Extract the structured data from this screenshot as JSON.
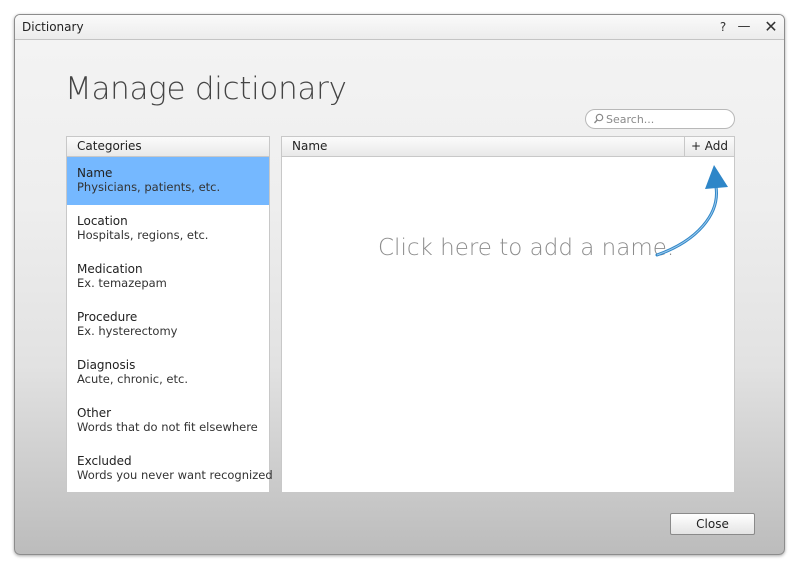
{
  "window": {
    "title": "Dictionary",
    "help_label": "?",
    "minimize_label": "—",
    "close_label": "✕"
  },
  "heading": "Manage dictionary",
  "search": {
    "placeholder": "Search..."
  },
  "categories": {
    "header": "Categories",
    "items": [
      {
        "title": "Name",
        "desc": "Physicians, patients, etc.",
        "selected": true
      },
      {
        "title": "Location",
        "desc": "Hospitals, regions, etc."
      },
      {
        "title": "Medication",
        "desc": "Ex. temazepam"
      },
      {
        "title": "Procedure",
        "desc": "Ex. hysterectomy"
      },
      {
        "title": "Diagnosis",
        "desc": "Acute, chronic, etc."
      },
      {
        "title": "Other",
        "desc": "Words that do not fit elsewhere"
      },
      {
        "title": "Excluded",
        "desc": "Words you never want recognized"
      }
    ]
  },
  "main": {
    "column_header": "Name",
    "add_label": "+ Add",
    "hint": "Click here to add a name."
  },
  "footer": {
    "close_label": "Close"
  },
  "colors": {
    "selection": "#75b8ff",
    "arrow": "#2e86c8"
  }
}
